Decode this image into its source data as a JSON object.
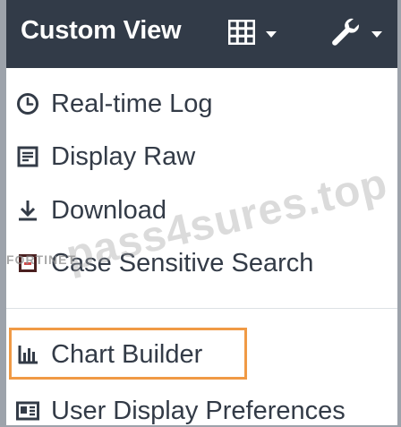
{
  "toolbar": {
    "title": "Custom View",
    "grid_icon": "grid-icon",
    "wrench_icon": "wrench-icon"
  },
  "menu": {
    "items": [
      {
        "label": "Real-time Log",
        "icon": "clock-icon"
      },
      {
        "label": "Display Raw",
        "icon": "document-icon"
      },
      {
        "label": "Download",
        "icon": "download-icon"
      },
      {
        "label": "Case Sensitive Search",
        "icon": "checkbox-icon"
      },
      {
        "label": "Chart Builder",
        "icon": "chart-icon"
      },
      {
        "label": "User Display Preferences",
        "icon": "id-card-icon"
      }
    ]
  },
  "overlay": {
    "watermark": "pass4sures.top",
    "brand": "FORTINET"
  },
  "colors": {
    "toolbar_bg": "#323b48",
    "menu_text": "#333b47",
    "highlight": "#f09a45",
    "frame_border": "#9da3ab"
  }
}
